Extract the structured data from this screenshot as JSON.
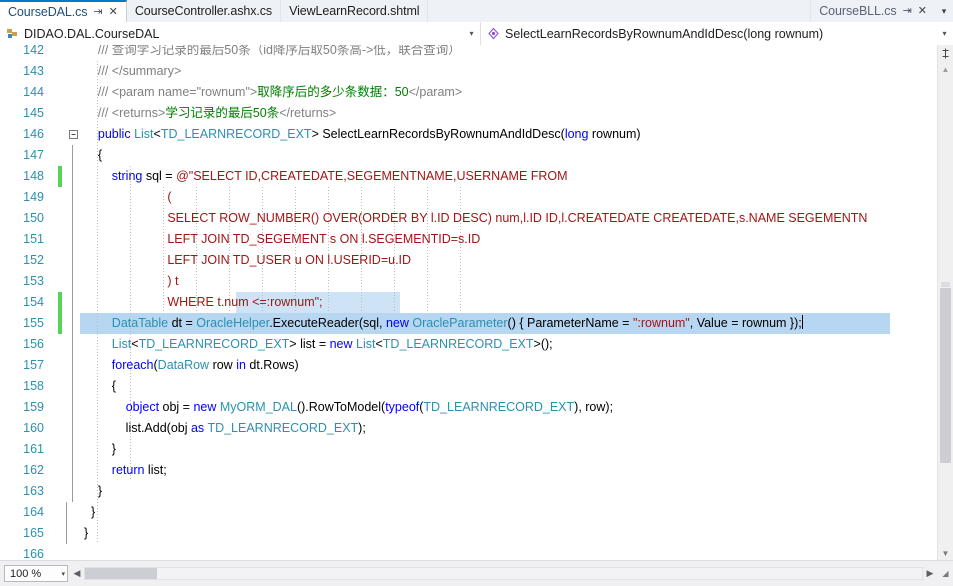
{
  "tabs": [
    {
      "label": "CourseDAL.cs",
      "active": true,
      "pin_icon": "pin-icon",
      "close_icon": "close-icon"
    },
    {
      "label": "CourseController.ashx.cs",
      "active": false
    },
    {
      "label": "ViewLearnRecord.shtml",
      "active": false
    }
  ],
  "tabs_right": [
    {
      "label": "CourseBLL.cs",
      "pin_icon": "pin-icon",
      "close_icon": "close-icon"
    }
  ],
  "tabstrip": {
    "overflow_label": "▾"
  },
  "navbar": {
    "type_dropdown": {
      "icon": "class-icon",
      "value": "DIDAO.DAL.CourseDAL",
      "arrow": "▾"
    },
    "member_dropdown": {
      "icon": "method-icon",
      "value": "SelectLearnRecordsByRownumAndIdDesc(long rownum)",
      "arrow": "▾"
    }
  },
  "editor": {
    "first_visible_line": 142,
    "lines": [
      {
        "n": 142,
        "changed": false,
        "fold": "",
        "clipped": true,
        "tokens": [
          {
            "t": "    ",
            "c": "plain"
          },
          {
            "t": "/// 查询学习记录的最后50条（id降序后取50条高->低，联合查询）",
            "c": "cmt"
          }
        ]
      },
      {
        "n": 143,
        "changed": false,
        "fold": "",
        "tokens": [
          {
            "t": "    ",
            "c": "plain"
          },
          {
            "t": "/// </summary>",
            "c": "cmt"
          }
        ]
      },
      {
        "n": 144,
        "changed": false,
        "fold": "",
        "tokens": [
          {
            "t": "    ",
            "c": "plain"
          },
          {
            "t": "/// <param name=\"rownum\">",
            "c": "cmt"
          },
          {
            "t": "取降序后的多少条数据：50",
            "c": "cn"
          },
          {
            "t": "</param>",
            "c": "cmt"
          }
        ]
      },
      {
        "n": 145,
        "changed": false,
        "fold": "",
        "tokens": [
          {
            "t": "    ",
            "c": "plain"
          },
          {
            "t": "/// <returns>",
            "c": "cmt"
          },
          {
            "t": "学习记录的最后50条",
            "c": "cn"
          },
          {
            "t": "</returns>",
            "c": "cmt"
          }
        ]
      },
      {
        "n": 146,
        "changed": false,
        "fold": "minus",
        "tokens": [
          {
            "t": "    ",
            "c": "plain"
          },
          {
            "t": "public",
            "c": "kw"
          },
          {
            "t": " ",
            "c": "plain"
          },
          {
            "t": "List",
            "c": "type"
          },
          {
            "t": "<",
            "c": "plain"
          },
          {
            "t": "TD_LEARNRECORD_EXT",
            "c": "type"
          },
          {
            "t": "> SelectLearnRecordsByRownumAndIdDesc(",
            "c": "plain"
          },
          {
            "t": "long",
            "c": "kw"
          },
          {
            "t": " rownum)",
            "c": "plain"
          }
        ]
      },
      {
        "n": 147,
        "changed": false,
        "fold": "",
        "tokens": [
          {
            "t": "    {",
            "c": "plain"
          }
        ]
      },
      {
        "n": 148,
        "changed": true,
        "fold": "",
        "tokens": [
          {
            "t": "        ",
            "c": "plain"
          },
          {
            "t": "string",
            "c": "kw"
          },
          {
            "t": " sql = ",
            "c": "plain"
          },
          {
            "t": "@\"SELECT ID,CREATEDATE,SEGEMENTNAME,USERNAME FROM",
            "c": "str"
          }
        ]
      },
      {
        "n": 149,
        "changed": false,
        "fold": "",
        "tokens": [
          {
            "t": "                        (",
            "c": "str"
          }
        ]
      },
      {
        "n": 150,
        "changed": false,
        "fold": "",
        "tokens": [
          {
            "t": "                        SELECT ROW_NUMBER() OVER(ORDER BY l.ID DESC) num,l.ID ID,l.CREATEDATE CREATEDATE,s.NAME SEGEMENTN",
            "c": "str"
          }
        ]
      },
      {
        "n": 151,
        "changed": false,
        "fold": "",
        "tokens": [
          {
            "t": "                        LEFT JOIN TD_SEGEMENT s ON l.SEGEMENTID=s.ID",
            "c": "str"
          }
        ]
      },
      {
        "n": 152,
        "changed": false,
        "fold": "",
        "tokens": [
          {
            "t": "                        LEFT JOIN TD_USER u ON l.USERID=u.ID",
            "c": "str"
          }
        ]
      },
      {
        "n": 153,
        "changed": false,
        "fold": "",
        "tokens": [
          {
            "t": "                        ) t",
            "c": "str"
          }
        ]
      },
      {
        "n": 154,
        "changed": true,
        "fold": "",
        "highlight": true,
        "tokens": [
          {
            "t": "                        WHERE t.num <=:rownum\";",
            "c": "str"
          }
        ]
      },
      {
        "n": 155,
        "changed": true,
        "fold": "",
        "selected": true,
        "caret_end": true,
        "tokens": [
          {
            "t": "        ",
            "c": "plain"
          },
          {
            "t": "DataTable",
            "c": "type"
          },
          {
            "t": " dt = ",
            "c": "plain"
          },
          {
            "t": "OracleHelper",
            "c": "type"
          },
          {
            "t": ".ExecuteReader(sql, ",
            "c": "plain"
          },
          {
            "t": "new",
            "c": "kw"
          },
          {
            "t": " ",
            "c": "plain"
          },
          {
            "t": "OracleParameter",
            "c": "type"
          },
          {
            "t": "() { ParameterName = ",
            "c": "plain"
          },
          {
            "t": "\":rownum\"",
            "c": "str"
          },
          {
            "t": ", Value = rownum });",
            "c": "plain"
          }
        ]
      },
      {
        "n": 156,
        "changed": false,
        "fold": "",
        "tokens": [
          {
            "t": "        ",
            "c": "plain"
          },
          {
            "t": "List",
            "c": "type"
          },
          {
            "t": "<",
            "c": "plain"
          },
          {
            "t": "TD_LEARNRECORD_EXT",
            "c": "type"
          },
          {
            "t": "> list = ",
            "c": "plain"
          },
          {
            "t": "new",
            "c": "kw"
          },
          {
            "t": " ",
            "c": "plain"
          },
          {
            "t": "List",
            "c": "type"
          },
          {
            "t": "<",
            "c": "plain"
          },
          {
            "t": "TD_LEARNRECORD_EXT",
            "c": "type"
          },
          {
            "t": ">();",
            "c": "plain"
          }
        ]
      },
      {
        "n": 157,
        "changed": false,
        "fold": "",
        "tokens": [
          {
            "t": "        ",
            "c": "plain"
          },
          {
            "t": "foreach",
            "c": "kw"
          },
          {
            "t": "(",
            "c": "plain"
          },
          {
            "t": "DataRow",
            "c": "type"
          },
          {
            "t": " row ",
            "c": "plain"
          },
          {
            "t": "in",
            "c": "kw"
          },
          {
            "t": " dt.Rows)",
            "c": "plain"
          }
        ]
      },
      {
        "n": 158,
        "changed": false,
        "fold": "",
        "tokens": [
          {
            "t": "        {",
            "c": "plain"
          }
        ]
      },
      {
        "n": 159,
        "changed": false,
        "fold": "",
        "tokens": [
          {
            "t": "            ",
            "c": "plain"
          },
          {
            "t": "object",
            "c": "kw"
          },
          {
            "t": " obj = ",
            "c": "plain"
          },
          {
            "t": "new",
            "c": "kw"
          },
          {
            "t": " ",
            "c": "plain"
          },
          {
            "t": "MyORM_DAL",
            "c": "type"
          },
          {
            "t": "().RowToModel(",
            "c": "plain"
          },
          {
            "t": "typeof",
            "c": "kw"
          },
          {
            "t": "(",
            "c": "plain"
          },
          {
            "t": "TD_LEARNRECORD_EXT",
            "c": "type"
          },
          {
            "t": "), row);",
            "c": "plain"
          }
        ]
      },
      {
        "n": 160,
        "changed": false,
        "fold": "",
        "tokens": [
          {
            "t": "            list.Add(obj ",
            "c": "plain"
          },
          {
            "t": "as",
            "c": "kw"
          },
          {
            "t": " ",
            "c": "plain"
          },
          {
            "t": "TD_LEARNRECORD_EXT",
            "c": "type"
          },
          {
            "t": ");",
            "c": "plain"
          }
        ]
      },
      {
        "n": 161,
        "changed": false,
        "fold": "",
        "tokens": [
          {
            "t": "        }",
            "c": "plain"
          }
        ]
      },
      {
        "n": 162,
        "changed": false,
        "fold": "",
        "tokens": [
          {
            "t": "        ",
            "c": "plain"
          },
          {
            "t": "return",
            "c": "kw"
          },
          {
            "t": " list;",
            "c": "plain"
          }
        ]
      },
      {
        "n": 163,
        "changed": false,
        "fold": "",
        "tokens": [
          {
            "t": "    }",
            "c": "plain"
          }
        ]
      },
      {
        "n": 164,
        "changed": false,
        "fold": "",
        "tokens": [
          {
            "t": "  }",
            "c": "plain"
          }
        ]
      },
      {
        "n": 165,
        "changed": false,
        "fold": "",
        "tokens": [
          {
            "t": "}",
            "c": "plain"
          }
        ]
      },
      {
        "n": 166,
        "changed": false,
        "fold": "",
        "tokens": [
          {
            "t": "",
            "c": "plain"
          }
        ]
      }
    ]
  },
  "scrollbar": {
    "split_icon": "split-view-icon",
    "up_arrow": "▲",
    "down_arrow": "▼"
  },
  "statusbar": {
    "zoom_value": "100 %",
    "zoom_arrow": "▾",
    "hscroll_left": "◀",
    "hscroll_right": "▶",
    "resize_grip": "resize-grip"
  },
  "colors": {
    "accent": "#007acc",
    "keyword": "#0000ff",
    "type": "#2b91af",
    "string": "#a31515",
    "comment": "#808080",
    "chinese_comment": "#008000",
    "linenumber": "#2b91af",
    "selection": "#b6d6f2",
    "change_bar": "#57d457"
  }
}
